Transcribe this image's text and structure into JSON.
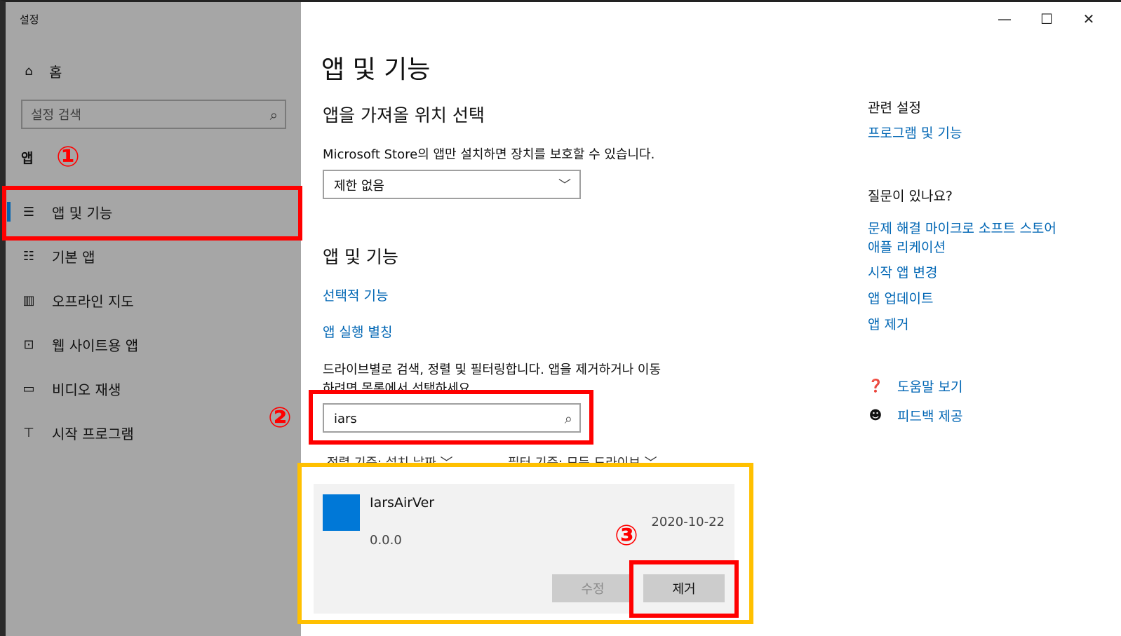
{
  "window": {
    "title": "설정",
    "minimize": "—",
    "maximize": "☐",
    "close": "✕"
  },
  "sidebar": {
    "home_label": "홈",
    "search_placeholder": "설정 검색",
    "section_label": "앱",
    "items": [
      {
        "label": "앱 및 기능",
        "icon": "list-icon",
        "active": true
      },
      {
        "label": "기본 앱",
        "icon": "default-apps-icon"
      },
      {
        "label": "오프라인 지도",
        "icon": "map-icon"
      },
      {
        "label": "웹 사이트용 앱",
        "icon": "web-app-icon"
      },
      {
        "label": "비디오 재생",
        "icon": "video-icon"
      },
      {
        "label": "시작 프로그램",
        "icon": "startup-icon"
      }
    ]
  },
  "main": {
    "title": "앱 및 기능",
    "source_heading": "앱을 가져올 위치 선택",
    "source_desc": "Microsoft Store의 앱만 설치하면 장치를 보호할 수 있습니다.",
    "source_value": "제한 없음",
    "apps_heading": "앱 및 기능",
    "optional_features_link": "선택적 기능",
    "app_alias_link": "앱 실행 별칭",
    "filter_desc_line1": "드라이브별로 검색, 정렬 및 필터링합니다. 앱을 제거하거나 이동",
    "filter_desc_line2": "하려면 목록에서 선택하세요.",
    "search_value": "iars",
    "sort_label": "정렬 기준: 설치 날짜",
    "filter_label": "필터 기준: 모든 드라이브",
    "app": {
      "name": "IarsAirVer",
      "version": "0.0.0",
      "date": "2020-10-22",
      "modify_label": "수정",
      "remove_label": "제거",
      "tile_color": "#0078d7"
    }
  },
  "right": {
    "related_heading": "관련 설정",
    "programs_link": "프로그램 및 기능",
    "question_heading": "질문이 있나요?",
    "links": [
      "문제 해결 마이크로 소프트 스토어",
      "애플 리케이션",
      "시작 앱 변경",
      "앱 업데이트",
      "앱 제거"
    ],
    "help_link": "도움말 보기",
    "feedback_link": "피드백 제공"
  },
  "annotations": {
    "step1": "①",
    "step2": "②",
    "step3": "③",
    "red": "#ff0000",
    "yellow": "#ffc000"
  },
  "colors": {
    "sidebar_bg": "#a6a6a6",
    "link": "#0066b4",
    "accent": "#0063b1"
  }
}
